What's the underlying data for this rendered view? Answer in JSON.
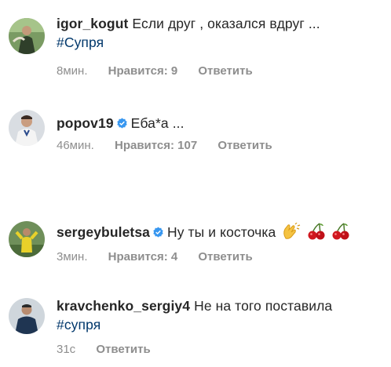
{
  "comments": [
    {
      "username": "igor_kogut",
      "verified": false,
      "text": "Если друг , оказался вдруг ...",
      "hashtag": "#Супря",
      "time": "8мин.",
      "likes": "Нравится: 9",
      "reply": "Ответить"
    },
    {
      "username": "popov19",
      "verified": true,
      "text": "Еба*а ...",
      "time": "46мин.",
      "likes": "Нравится: 107",
      "reply": "Ответить"
    },
    {
      "username": "sergeybuletsa",
      "verified": true,
      "text": "Ну ты и косточка",
      "emojis": [
        "clapping-hands-icon",
        "cherries-icon",
        "cherries-icon"
      ],
      "time": "3мин.",
      "likes": "Нравится: 4",
      "reply": "Ответить"
    },
    {
      "username": "kravchenko_sergiy4",
      "verified": false,
      "text": "Не на того поставила",
      "hashtag": "#супря",
      "time": "31с",
      "reply": "Ответить"
    }
  ],
  "colors": {
    "username": "#262626",
    "hashtag": "#00376b",
    "meta": "#8e8e8e",
    "verified_badge": "#3897f0"
  }
}
